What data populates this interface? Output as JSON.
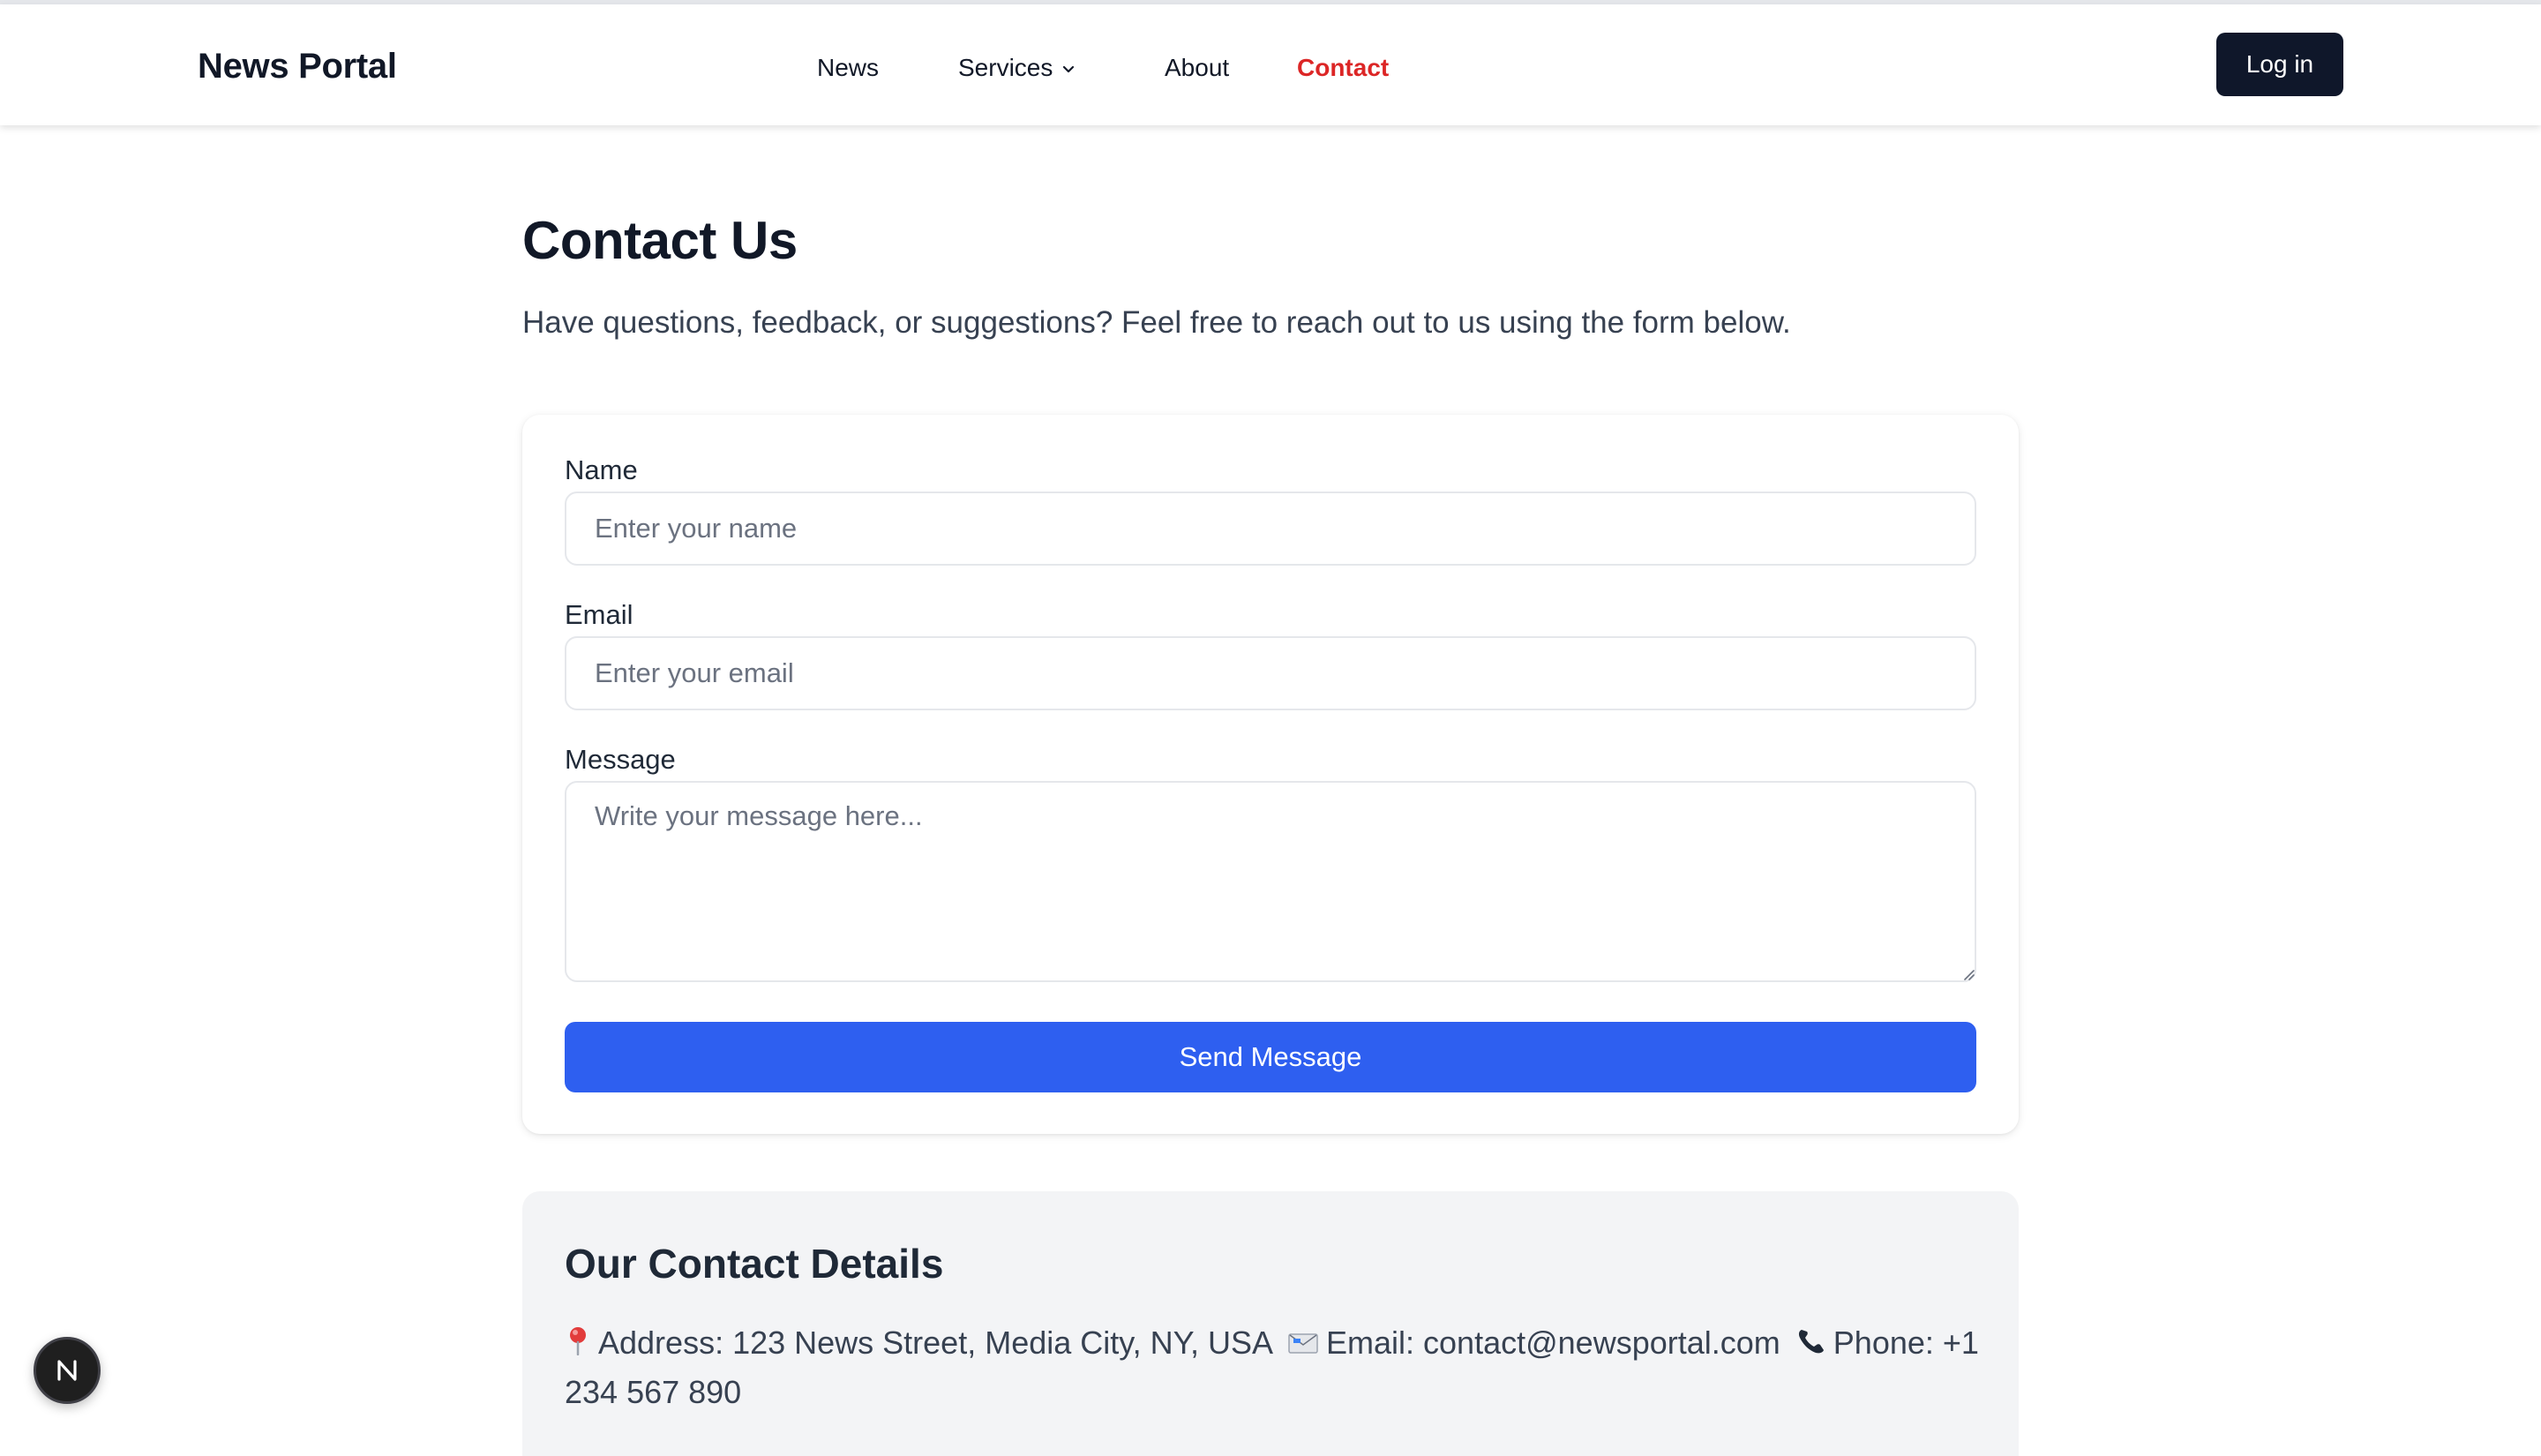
{
  "header": {
    "brand": "News Portal",
    "nav": {
      "news": "News",
      "services": "Services",
      "about": "About",
      "contact": "Contact"
    },
    "login_label": "Log in"
  },
  "main": {
    "title": "Contact Us",
    "subtitle": "Have questions, feedback, or suggestions? Feel free to reach out to us using the form below."
  },
  "form": {
    "name_label": "Name",
    "name_placeholder": "Enter your name",
    "name_value": "",
    "email_label": "Email",
    "email_placeholder": "Enter your email",
    "email_value": "",
    "message_label": "Message",
    "message_placeholder": "Write your message here...",
    "message_value": "",
    "submit_label": "Send Message"
  },
  "details": {
    "title": "Our Contact Details",
    "address": "Address: 123 News Street, Media City, NY, USA",
    "email": "Email: contact@newsportal.com",
    "phone": "Phone: +1 234 567 890",
    "icons": {
      "address": "pin-icon",
      "email": "envelope-icon",
      "phone": "phone-icon"
    }
  },
  "colors": {
    "active_nav": "#dc2626",
    "primary_button": "#2e5ff0",
    "dark_button": "#0f172a"
  }
}
